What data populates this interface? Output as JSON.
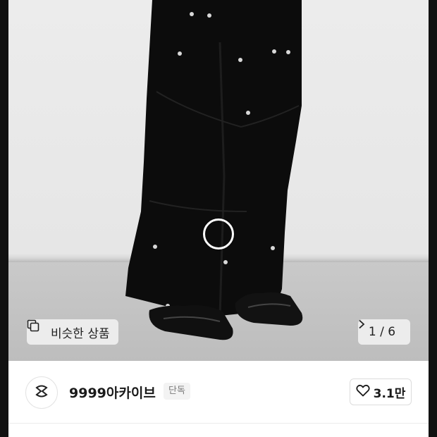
{
  "hero": {
    "similar_button_label": "비슷한 상품",
    "image_counter": "1 / 6",
    "counter_icon": "chevron-right-icon",
    "similar_icon": "similar-items-icon"
  },
  "seller": {
    "name": "9999아카이브",
    "badge": "단독",
    "avatar_icon": "brand-logo-icon"
  },
  "like": {
    "count": "3.1만",
    "icon": "heart-outline-icon"
  },
  "colors": {
    "background": "#ffffff",
    "text": "#1a1a1a",
    "badge_bg": "#f3f3f3",
    "badge_text": "#7a7a7a"
  }
}
